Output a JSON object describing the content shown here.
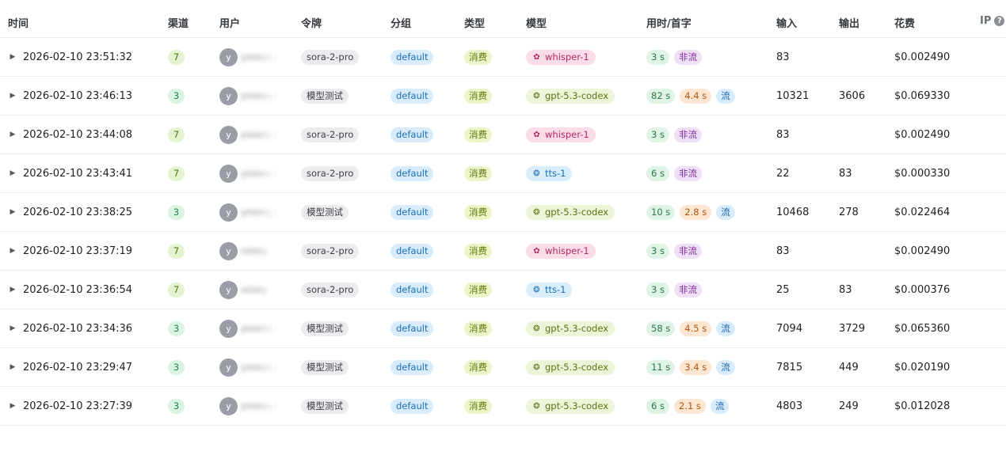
{
  "headers": {
    "time": "时间",
    "channel": "渠道",
    "user": "用户",
    "token": "令牌",
    "group": "分组",
    "type": "类型",
    "model": "模型",
    "usetime": "用时/首字",
    "input": "输入",
    "output": "输出",
    "cost": "花费",
    "ip": "IP",
    "ip_help_icon": "question-circle-icon"
  },
  "colors": {
    "channel_7": "#e4f4d0",
    "channel_3": "#dbf3e3",
    "group": "#d8ecfb",
    "type": "#ecf5c7",
    "model_whisper": "#fbdde9",
    "model_codex": "#ecf5d8",
    "model_tts": "#d9eefb",
    "duration": "#dff3e6",
    "first_token": "#fde6d2",
    "non_stream": "#efdff7",
    "stream": "#d9ecfb"
  },
  "rows": [
    {
      "time": "2026-02-10 23:51:32",
      "channel": "7",
      "channel_color": "lime",
      "avatar": "y",
      "user": "yxxxxy",
      "token": "sora-2-pro",
      "group": "default",
      "type": "消费",
      "model": "whisper-1",
      "model_color": "pink",
      "duration": "3 s",
      "first": "",
      "stream": "非流",
      "stream_color": "purple",
      "input": "83",
      "output": "",
      "cost": "$0.002490"
    },
    {
      "time": "2026-02-10 23:46:13",
      "channel": "3",
      "channel_color": "green",
      "avatar": "y",
      "user": "yxxxxy",
      "token": "模型测试",
      "group": "default",
      "type": "消费",
      "model": "gpt-5.3-codex",
      "model_color": "lime",
      "duration": "82 s",
      "first": "4.4 s",
      "stream": "流",
      "stream_color": "blue",
      "input": "10321",
      "output": "3606",
      "cost": "$0.069330"
    },
    {
      "time": "2026-02-10 23:44:08",
      "channel": "7",
      "channel_color": "lime",
      "avatar": "y",
      "user": "yxxxxy",
      "token": "sora-2-pro",
      "group": "default",
      "type": "消费",
      "model": "whisper-1",
      "model_color": "pink",
      "duration": "3 s",
      "first": "",
      "stream": "非流",
      "stream_color": "purple",
      "input": "83",
      "output": "",
      "cost": "$0.002490"
    },
    {
      "time": "2026-02-10 23:43:41",
      "channel": "7",
      "channel_color": "lime",
      "avatar": "y",
      "user": "yxxxxy",
      "token": "sora-2-pro",
      "group": "default",
      "type": "消费",
      "model": "tts-1",
      "model_color": "blue",
      "duration": "6 s",
      "first": "",
      "stream": "非流",
      "stream_color": "purple",
      "input": "22",
      "output": "83",
      "cost": "$0.000330"
    },
    {
      "time": "2026-02-10 23:38:25",
      "channel": "3",
      "channel_color": "green",
      "avatar": "y",
      "user": "ynxxxy",
      "token": "模型测试",
      "group": "default",
      "type": "消费",
      "model": "gpt-5.3-codex",
      "model_color": "lime",
      "duration": "10 s",
      "first": "2.8 s",
      "stream": "流",
      "stream_color": "blue",
      "input": "10468",
      "output": "278",
      "cost": "$0.022464"
    },
    {
      "time": "2026-02-10 23:37:19",
      "channel": "7",
      "channel_color": "lime",
      "avatar": "y",
      "user": "nzxxy",
      "token": "sora-2-pro",
      "group": "default",
      "type": "消费",
      "model": "whisper-1",
      "model_color": "pink",
      "duration": "3 s",
      "first": "",
      "stream": "非流",
      "stream_color": "purple",
      "input": "83",
      "output": "",
      "cost": "$0.002490"
    },
    {
      "time": "2026-02-10 23:36:54",
      "channel": "7",
      "channel_color": "lime",
      "avatar": "y",
      "user": "xzsxy",
      "token": "sora-2-pro",
      "group": "default",
      "type": "消费",
      "model": "tts-1",
      "model_color": "blue",
      "duration": "3 s",
      "first": "",
      "stream": "非流",
      "stream_color": "purple",
      "input": "25",
      "output": "83",
      "cost": "$0.000376"
    },
    {
      "time": "2026-02-10 23:34:36",
      "channel": "3",
      "channel_color": "green",
      "avatar": "y",
      "user": "yxxxxy",
      "token": "模型测试",
      "group": "default",
      "type": "消费",
      "model": "gpt-5.3-codex",
      "model_color": "lime",
      "duration": "58 s",
      "first": "4.5 s",
      "stream": "流",
      "stream_color": "blue",
      "input": "7094",
      "output": "3729",
      "cost": "$0.065360"
    },
    {
      "time": "2026-02-10 23:29:47",
      "channel": "3",
      "channel_color": "green",
      "avatar": "y",
      "user": "yxxxxy",
      "token": "模型测试",
      "group": "default",
      "type": "消费",
      "model": "gpt-5.3-codex",
      "model_color": "lime",
      "duration": "11 s",
      "first": "3.4 s",
      "stream": "流",
      "stream_color": "blue",
      "input": "7815",
      "output": "449",
      "cost": "$0.020190"
    },
    {
      "time": "2026-02-10 23:27:39",
      "channel": "3",
      "channel_color": "green",
      "avatar": "y",
      "user": "yxxxxy",
      "token": "模型测试",
      "group": "default",
      "type": "消费",
      "model": "gpt-5.3-codex",
      "model_color": "lime",
      "duration": "6 s",
      "first": "2.1 s",
      "stream": "流",
      "stream_color": "blue",
      "input": "4803",
      "output": "249",
      "cost": "$0.012028"
    }
  ]
}
